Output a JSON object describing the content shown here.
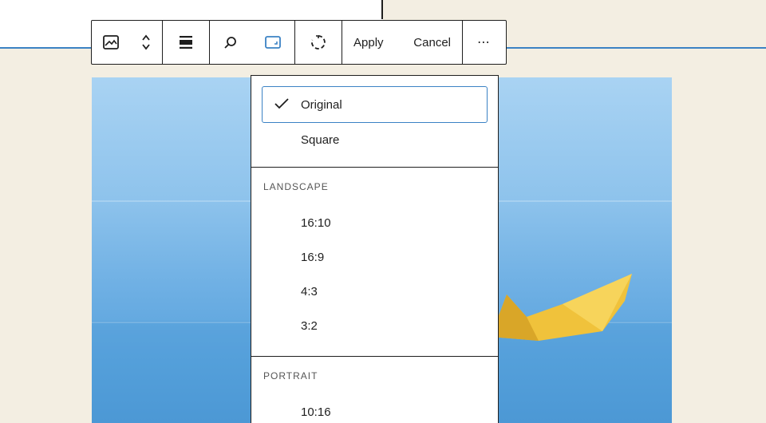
{
  "toolbar": {
    "apply_label": "Apply",
    "cancel_label": "Cancel",
    "more_label": "⋯",
    "icons": [
      "image-icon",
      "chevron-up-down-icon",
      "align-icon",
      "search-icon",
      "crop-icon",
      "rotate-icon",
      "more-icon"
    ]
  },
  "aspect_menu": {
    "top_items": [
      {
        "label": "Original",
        "selected": true
      },
      {
        "label": "Square",
        "selected": false
      }
    ],
    "landscape": {
      "title": "LANDSCAPE",
      "items": [
        "16:10",
        "16:9",
        "4:3",
        "3:2"
      ]
    },
    "portrait": {
      "title": "PORTRAIT",
      "items": [
        "10:16"
      ]
    }
  },
  "colors": {
    "accent": "#3b82c4",
    "border": "#1e1e1e",
    "sky": "#8ec3ec",
    "boat": "#f0c23b",
    "background": "#f3eee2"
  }
}
